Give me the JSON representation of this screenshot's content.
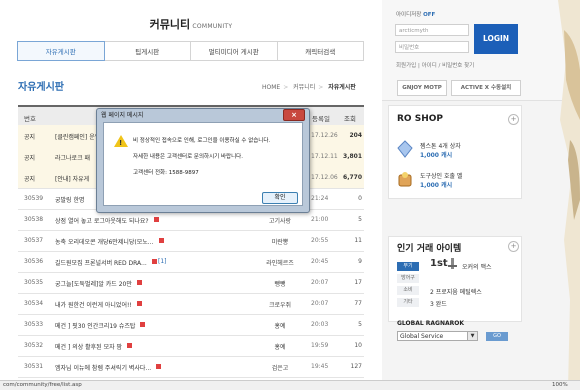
{
  "community": {
    "title": "커뮤니티",
    "subtitle": "COMMUNITY"
  },
  "tabs": [
    {
      "label": "자유게시판",
      "active": true
    },
    {
      "label": "팁게시판",
      "active": false
    },
    {
      "label": "멀티미디어 게시판",
      "active": false
    },
    {
      "label": "캐릭터검색",
      "active": false
    }
  ],
  "board_title": "자유게시판",
  "breadcrumb": [
    "HOME",
    "커뮤니티",
    "자유게시판"
  ],
  "table_headers": {
    "no": "번호",
    "title": "제목",
    "author": "등록일",
    "views": "조회"
  },
  "rows": [
    {
      "no": "공지",
      "title": "[클린캠페인] 운영",
      "author": "",
      "date": "17.12.26",
      "views": "204",
      "notice": true
    },
    {
      "no": "공지",
      "title": "라그나로크 패",
      "author": "",
      "date": "17.12.11",
      "views": "3,801",
      "notice": true
    },
    {
      "no": "공지",
      "title": "[안내] 자유게",
      "author": "",
      "date": "17.12.06",
      "views": "6,770",
      "notice": true
    },
    {
      "no": "30539",
      "title": "궁발링 한명",
      "author": "",
      "date": "21:24",
      "views": "0",
      "notice": false
    },
    {
      "no": "30538",
      "title": "상점 열어 놓고 로그아웃해도 되나요?",
      "author": "고기사랑",
      "date": "21:00",
      "views": "5",
      "notice": false
    },
    {
      "no": "30537",
      "title": "농축 오리데오콘 개당6만제니당(모노...",
      "author": "미란뽕",
      "date": "20:55",
      "views": "11",
      "notice": false
    },
    {
      "no": "30536",
      "title": "길드원모집 프론널서버 RED DRA...",
      "comments": "[1]",
      "author": "라인헤르즈",
      "date": "20:45",
      "views": "9",
      "notice": false
    },
    {
      "no": "30535",
      "title": "궁그늘[도둑벌레]알 카드 20만",
      "author": "뺑뺑",
      "date": "20:07",
      "views": "17",
      "notice": false
    },
    {
      "no": "30534",
      "title": "내가 원한건 이런게 아니었어!!",
      "author": "크로우쥐",
      "date": "20:07",
      "views": "77",
      "notice": false
    },
    {
      "no": "30533",
      "title": "메건 ] 핏30 인간크리19 슈즈탑",
      "author": "홍예",
      "date": "20:03",
      "views": "5",
      "notice": false
    },
    {
      "no": "30532",
      "title": "메건 ] 의상 활후된 모자 팜",
      "author": "홍예",
      "date": "19:59",
      "views": "10",
      "notice": false
    },
    {
      "no": "30531",
      "title": "엠자님 이뉴에 참렘 주셔릭기 벽사다...",
      "author": "검은고",
      "date": "19:45",
      "views": "127",
      "notice": false
    }
  ],
  "status_url": "com/community/free/list.asp",
  "status_zoom": "100%",
  "login": {
    "keep_id_label": "아이디저장",
    "keep_id_state": "OFF",
    "id_value": "arcticmyth",
    "pw_placeholder": "비밀번호",
    "button": "LOGIN",
    "links": "회원가입 | 아이디 / 비밀번호 찾기",
    "gnjoy": "GNJOY MOTP",
    "activex": "ACTIVE X 수동설치"
  },
  "ro_shop": {
    "title": "RO SHOP",
    "items": [
      {
        "name": "젬스톤 4개 상자",
        "price": "1,000 캐시"
      },
      {
        "name": "도구상인 호출 벨",
        "price": "1,000 캐시"
      }
    ]
  },
  "trade": {
    "title": "인기 거래 아이템",
    "tabs": [
      "무기",
      "방어구",
      "소비",
      "기타"
    ],
    "rank1": "1st",
    "first_item": "오커의 맥스",
    "second_item": "2 프로지움 메틸렉스",
    "third_item": "3 완드"
  },
  "global": {
    "title": "GLOBAL RAGNAROK",
    "selected": "Global Service"
  },
  "dialog": {
    "title": "웹 페이지 메시지",
    "line1": "비 정상적인 접속으로 인해, 로그인을 이용하실 수 없습니다.",
    "line2": "자세한 내용은 고객센터로 문의하시기 바랍니다.",
    "line3": "고객센터 전화: 1588-9897",
    "ok": "확인"
  }
}
